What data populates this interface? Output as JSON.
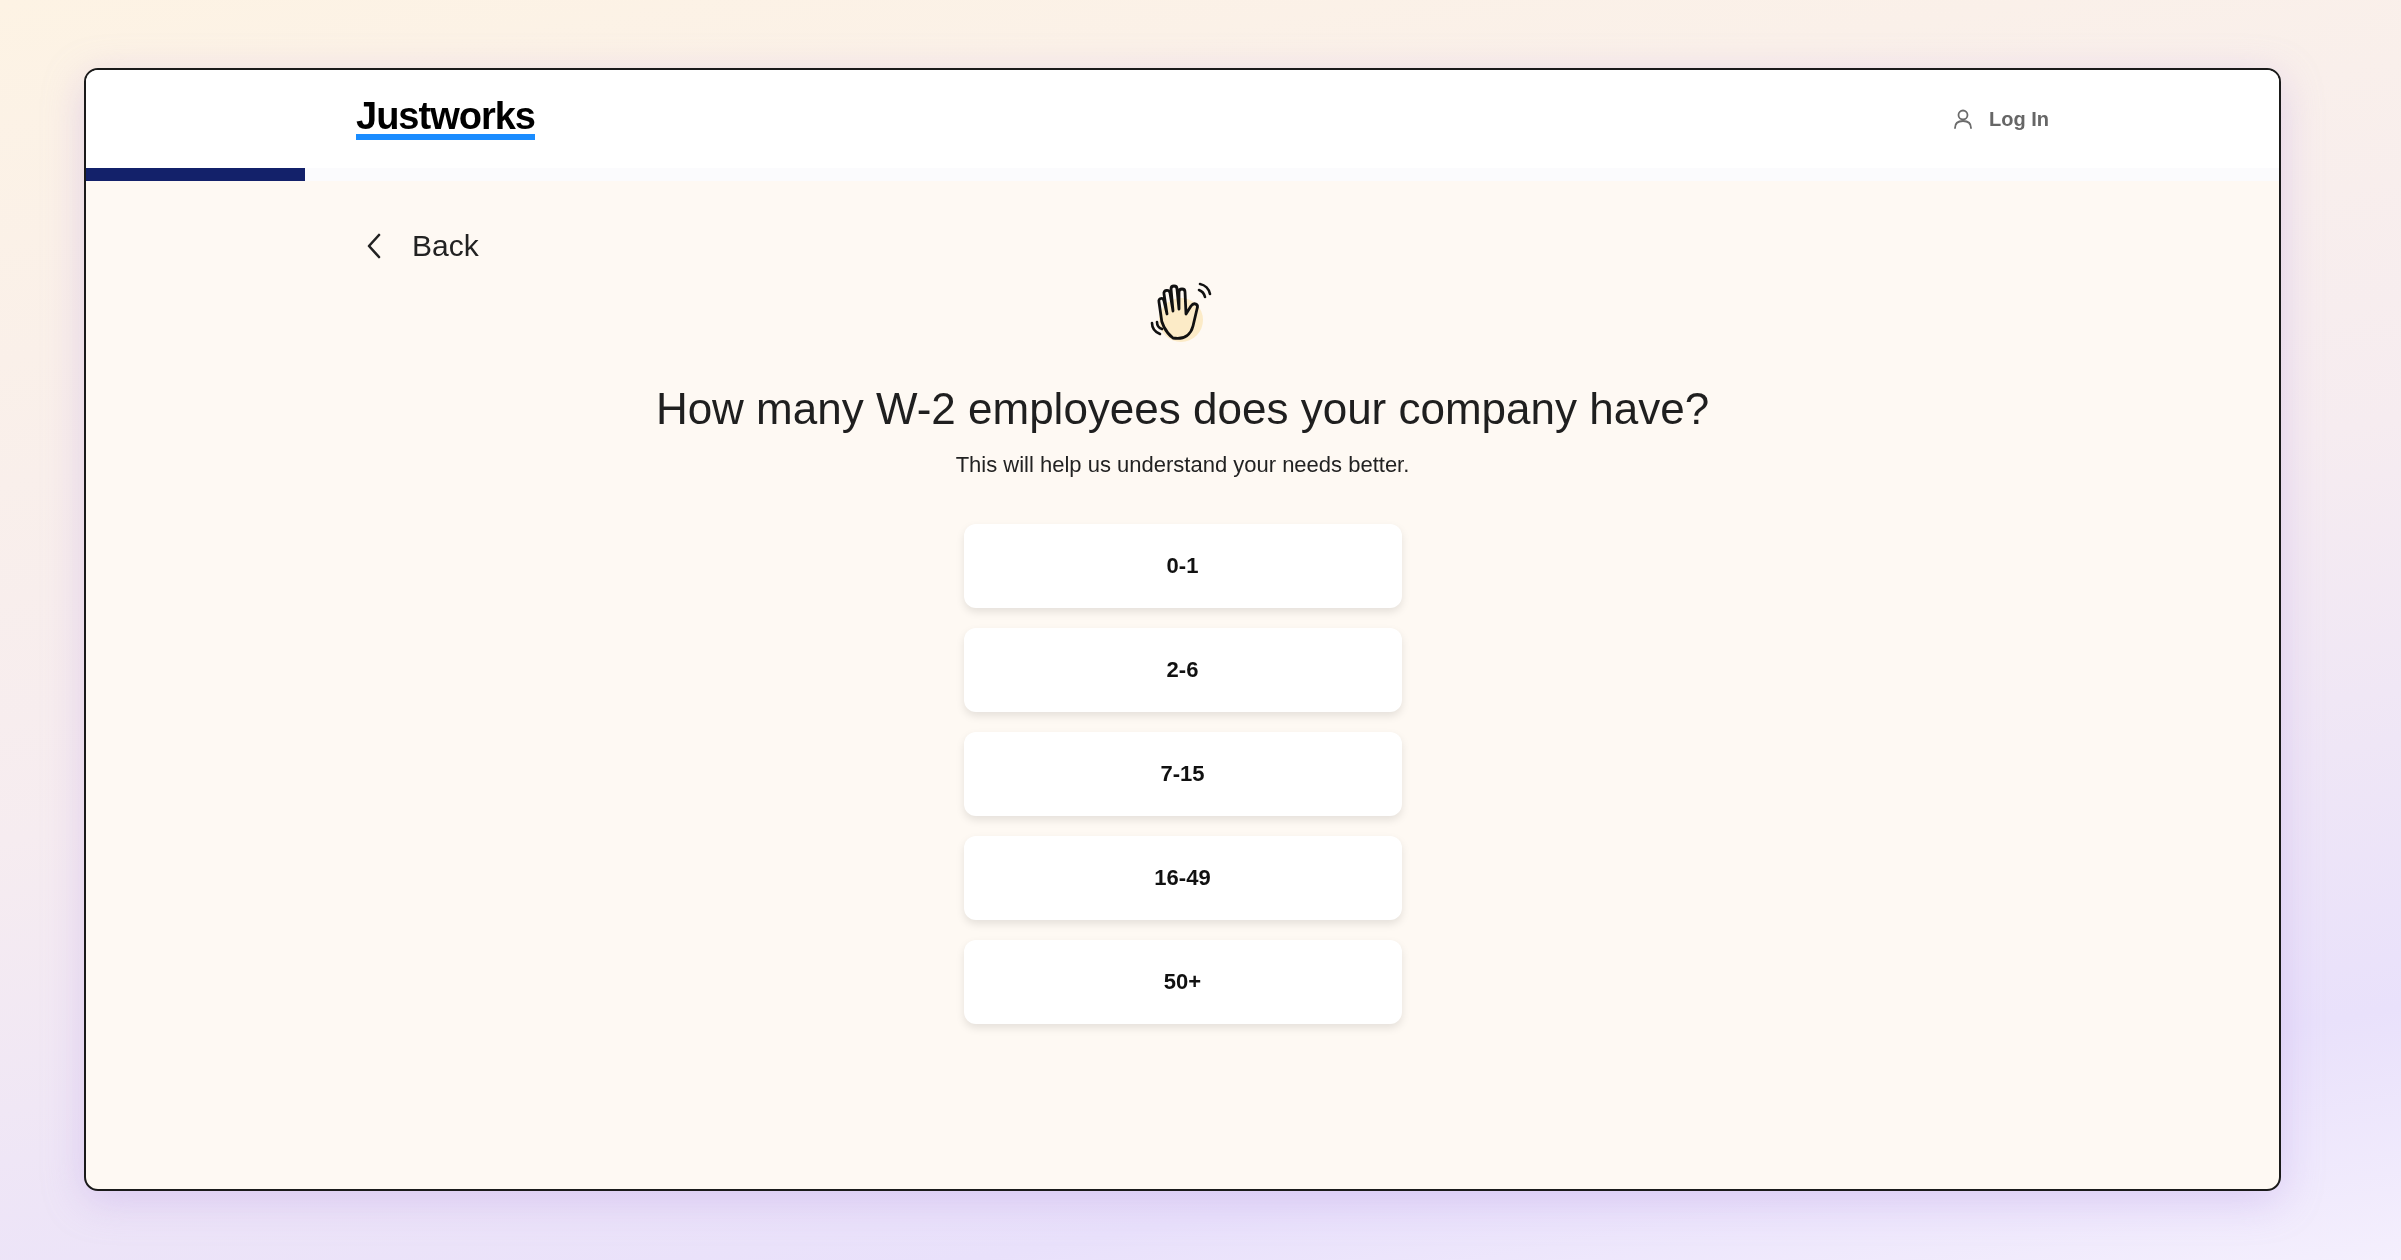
{
  "header": {
    "logo": "Justworks",
    "login": "Log In"
  },
  "progress": {
    "level": 0.1
  },
  "back": "Back",
  "question": {
    "title": "How many W-2 employees does your company have?",
    "subtitle": "This will help us understand your needs better."
  },
  "options": [
    {
      "label": "0-1"
    },
    {
      "label": "2-6"
    },
    {
      "label": "7-15"
    },
    {
      "label": "16-49"
    },
    {
      "label": "50+"
    }
  ]
}
